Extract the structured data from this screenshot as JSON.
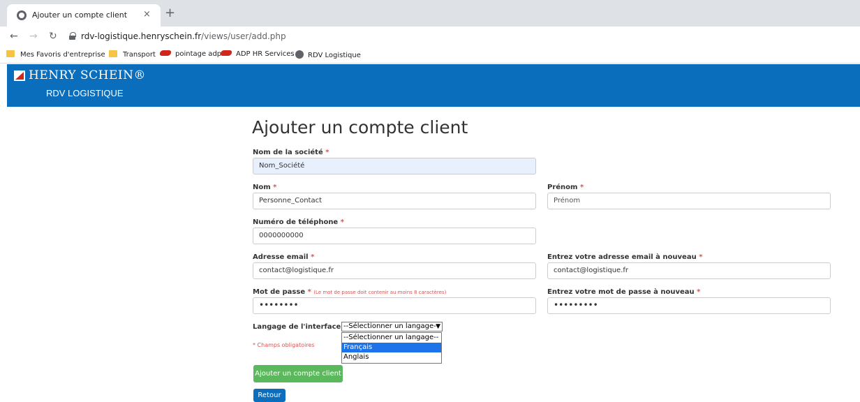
{
  "browser": {
    "tab_title": "Ajouter un compte client",
    "tab_close": "×",
    "new_tab": "+",
    "url_domain": "rdv-logistique.henryschein.fr",
    "url_path": "/views/user/add.php",
    "bookmarks": [
      {
        "label": "Mes Favoris d'entreprise",
        "icon": "folder-icon"
      },
      {
        "label": "Transport",
        "icon": "folder-icon"
      },
      {
        "label": "pointage adp",
        "icon": "adp-icon"
      },
      {
        "label": "ADP HR Services",
        "icon": "adp-icon"
      },
      {
        "label": "RDV Logistique",
        "icon": "globe-icon"
      }
    ]
  },
  "header": {
    "logo_text": "HENRY SCHEIN®",
    "subtitle": "RDV LOGISTIQUE",
    "color": "#0a6ebd"
  },
  "form": {
    "title": "Ajouter un compte client",
    "company_label": "Nom de la société",
    "company_value": "Nom_Société",
    "last_name_label": "Nom",
    "last_name_value": "Personne_Contact",
    "first_name_label": "Prénom",
    "first_name_placeholder": "Prénom",
    "phone_label": "Numéro de téléphone",
    "phone_value": "0000000000",
    "email_label": "Adresse email",
    "email_value": "contact@logistique.fr",
    "email_confirm_label": "Entrez votre adresse email à nouveau",
    "email_confirm_value": "contact@logistique.fr",
    "password_label": "Mot de passe",
    "password_hint": "(Le mot de passe doit contenir au moins 8 caractères)",
    "password_value": "••••••••",
    "password_confirm_label": "Entrez votre mot de passe à nouveau",
    "password_confirm_value": "•••••••••",
    "language_label": "Langage de l'interface",
    "language_selected": "--Sélectionner un langage--",
    "language_options": [
      "--Sélectionner un langage--",
      "Français",
      "Anglais"
    ],
    "required_star": "*",
    "required_note": "* Champs obligatoires",
    "submit_label": "Ajouter un compte client",
    "back_label": "Retour"
  }
}
